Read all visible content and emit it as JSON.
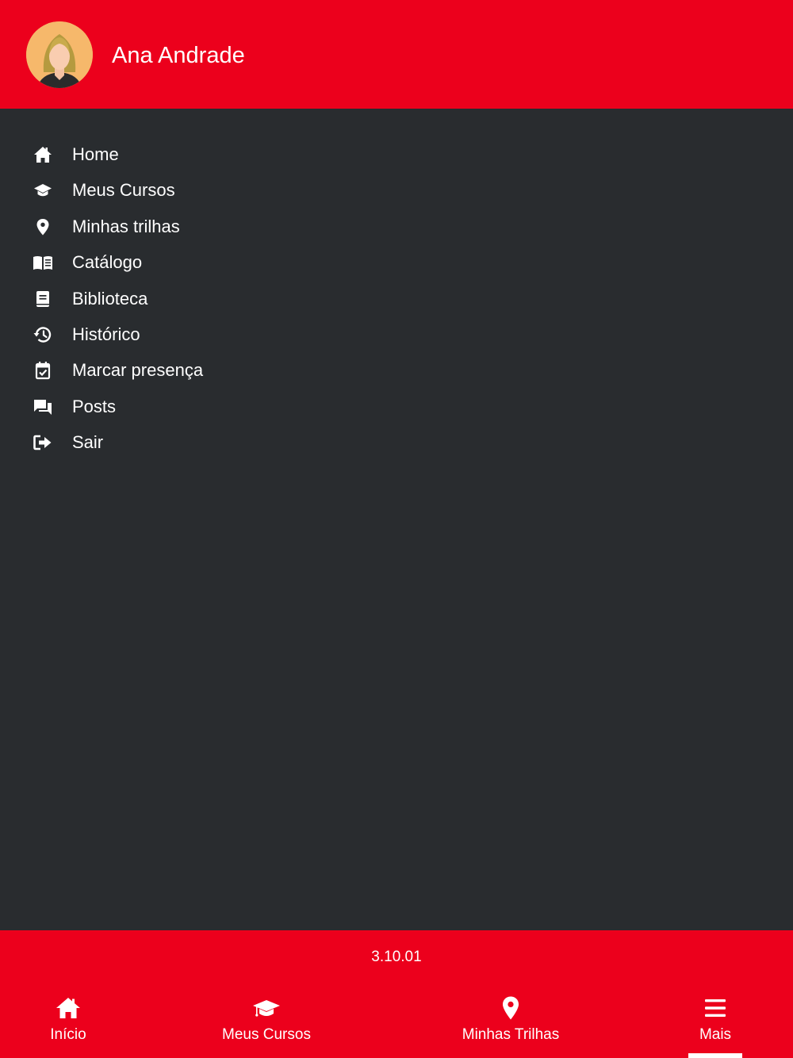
{
  "header": {
    "user_name": "Ana Andrade",
    "avatar_icon": "user-avatar-woman"
  },
  "menu": {
    "items": [
      {
        "label": "Home",
        "icon": "home-icon"
      },
      {
        "label": "Meus Cursos",
        "icon": "graduation-cap-icon"
      },
      {
        "label": "Minhas trilhas",
        "icon": "map-pin-icon"
      },
      {
        "label": "Catálogo",
        "icon": "open-book-icon"
      },
      {
        "label": "Biblioteca",
        "icon": "book-icon"
      },
      {
        "label": "Histórico",
        "icon": "history-icon"
      },
      {
        "label": "Marcar presença",
        "icon": "calendar-check-icon"
      },
      {
        "label": "Posts",
        "icon": "chat-icon"
      },
      {
        "label": "Sair",
        "icon": "logout-icon"
      }
    ]
  },
  "footer": {
    "version": "3.10.01"
  },
  "tabs": [
    {
      "label": "Início",
      "icon": "home-icon"
    },
    {
      "label": "Meus Cursos",
      "icon": "graduation-cap-icon"
    },
    {
      "label": "Minhas Trilhas",
      "icon": "map-pin-icon"
    },
    {
      "label": "Mais",
      "icon": "hamburger-menu-icon",
      "active": true
    }
  ],
  "colors": {
    "brand_red": "#ec001c",
    "panel_dark": "#292c2f",
    "text": "#ffffff"
  }
}
